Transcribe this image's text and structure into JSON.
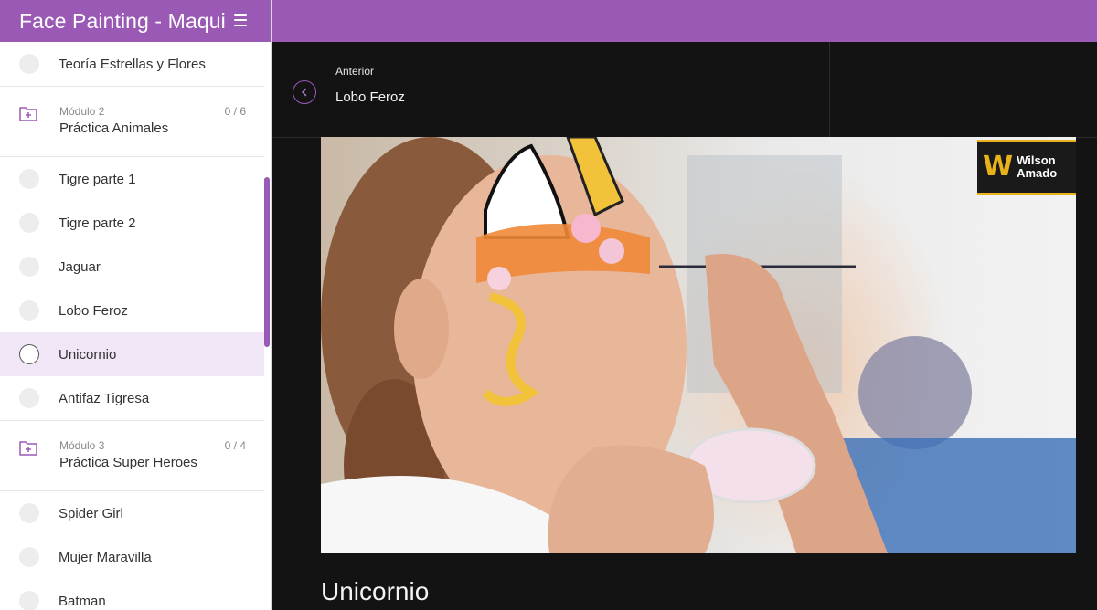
{
  "app": {
    "title": "Face Painting - Maquillaje"
  },
  "sidebar": {
    "sections": [
      {
        "lessons": [
          "Teoría Estrellas y Flores"
        ]
      },
      {
        "module_label": "Módulo 2",
        "module_name": "Práctica Animales",
        "progress": "0 / 6",
        "lessons": [
          "Tigre parte 1",
          "Tigre parte 2",
          "Jaguar",
          "Lobo Feroz",
          "Unicornio",
          "Antifaz Tigresa"
        ]
      },
      {
        "module_label": "Módulo 3",
        "module_name": "Práctica Super Heroes",
        "progress": "0 / 4",
        "lessons": [
          "Spider Girl",
          "Mujer Maravilla",
          "Batman"
        ]
      }
    ],
    "active_lesson": "Unicornio"
  },
  "nav": {
    "previous_label": "Anterior",
    "previous_title": "Lobo Feroz"
  },
  "video": {
    "logo_line1": "Wilson",
    "logo_line2": "Amado",
    "logo_mark": "W"
  },
  "lesson": {
    "title": "Unicornio"
  },
  "colors": {
    "accent": "#9b59b6",
    "active_bg": "#f0e6f5",
    "logo_gold": "#e8b21a"
  },
  "icons": {
    "menu": "hamburger-icon",
    "module": "folder-plus-icon",
    "previous": "chevron-left-icon"
  }
}
